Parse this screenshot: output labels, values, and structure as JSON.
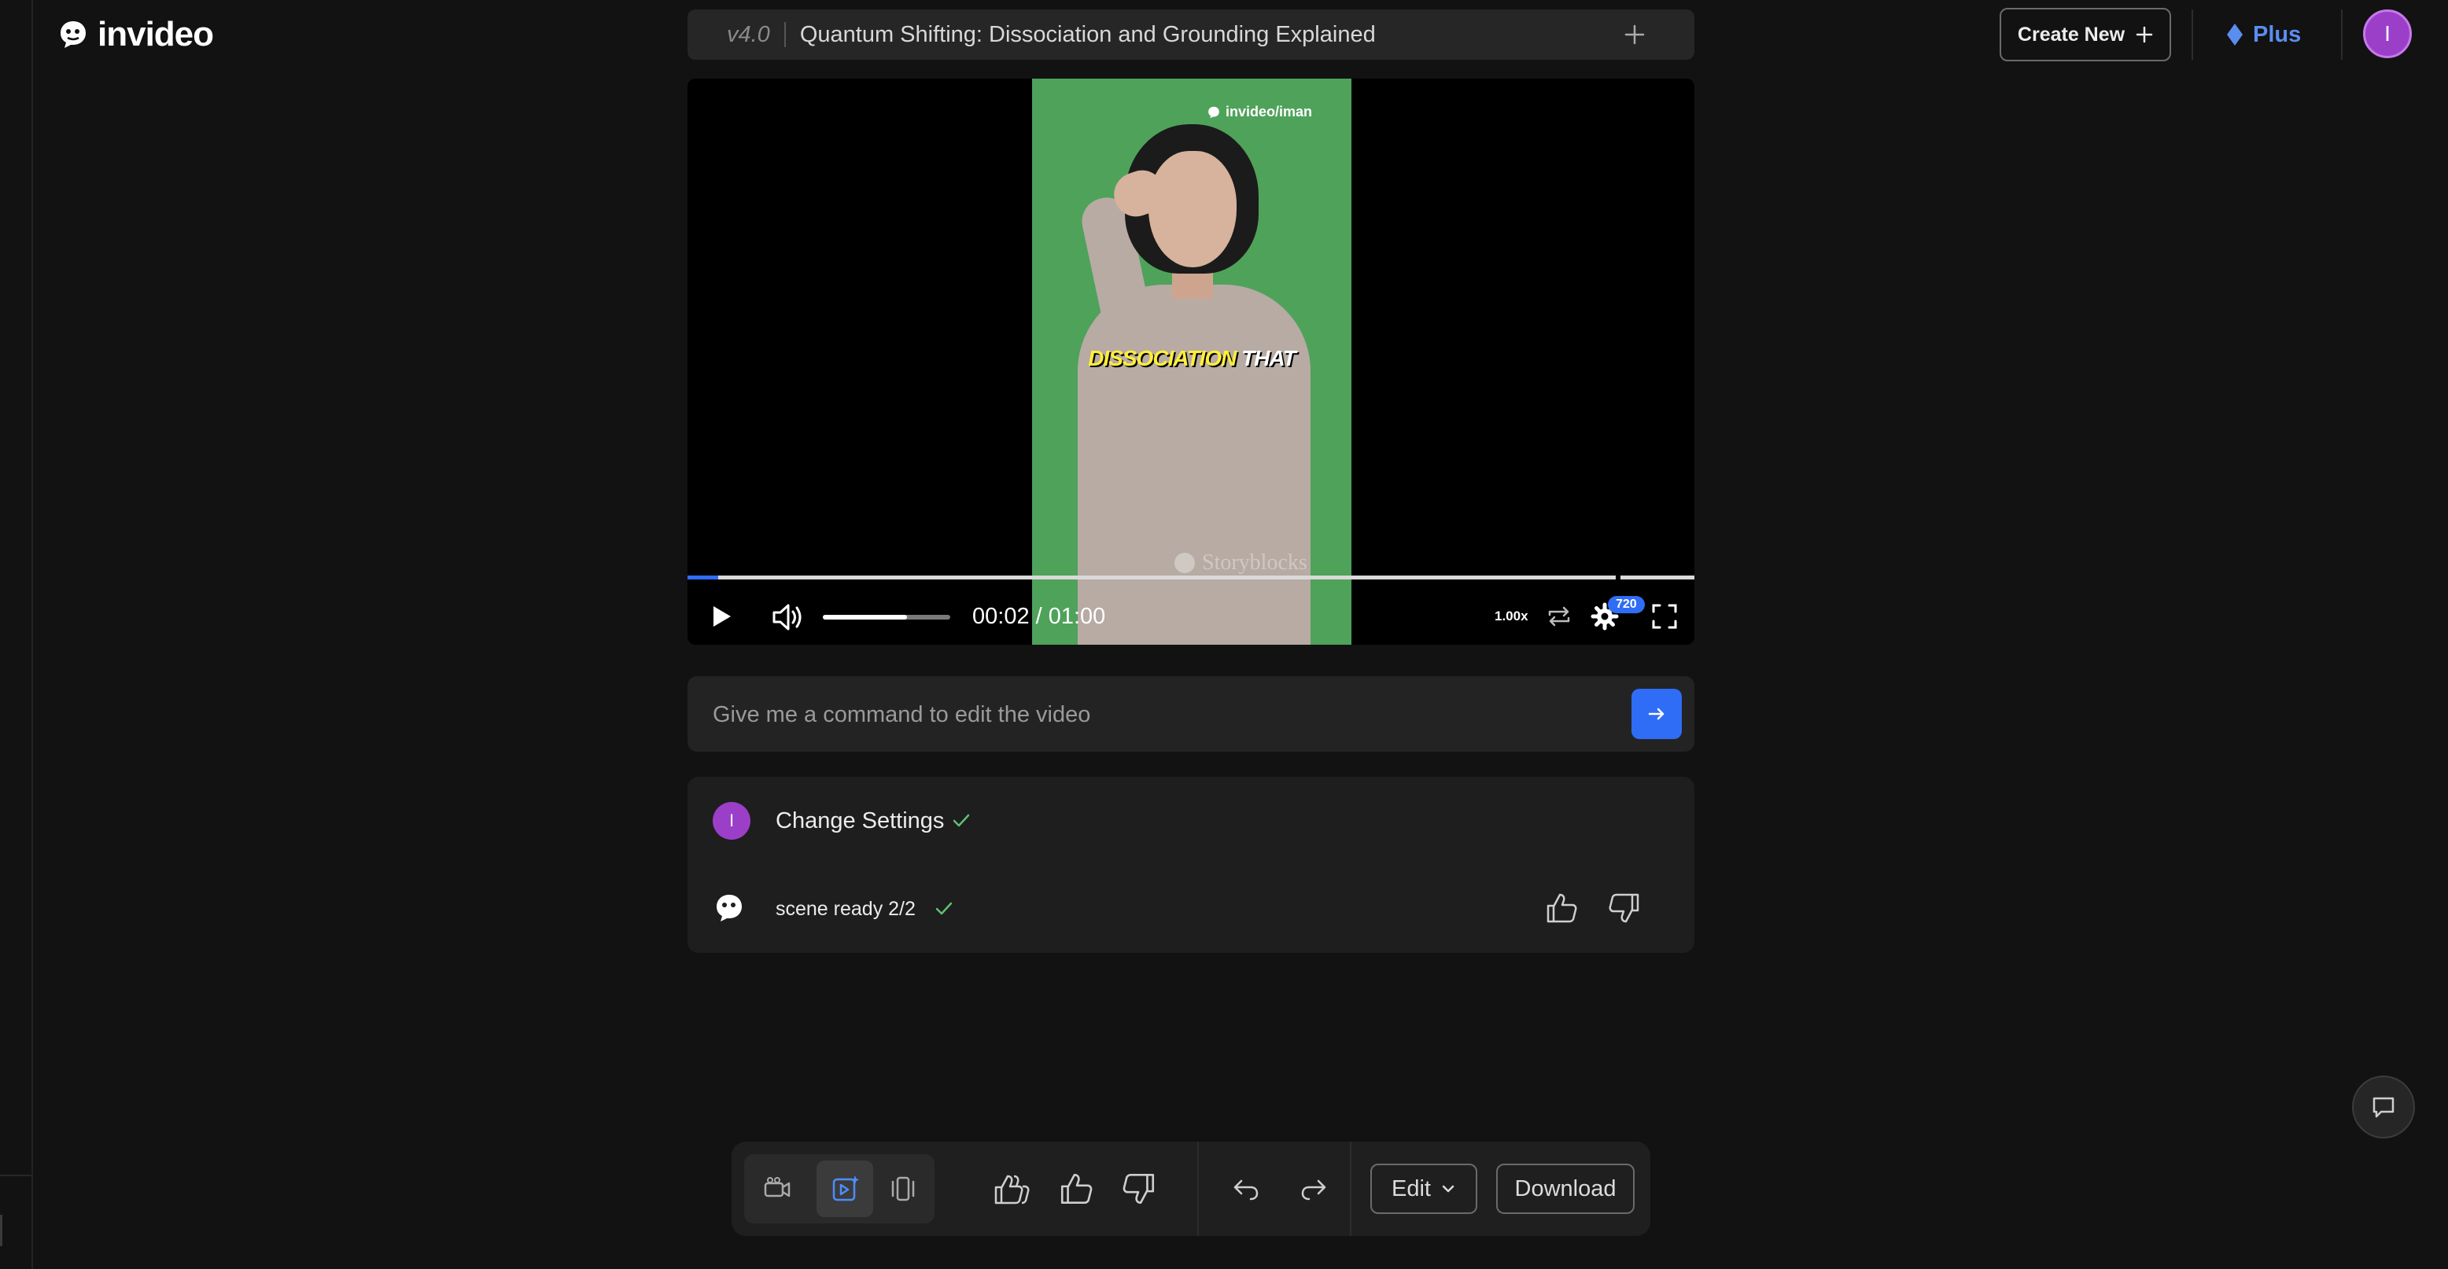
{
  "app": {
    "name": "invideo"
  },
  "header": {
    "version": "v4.0",
    "project_title": "Quantum Shifting: Dissociation and Grounding Explained",
    "create_new_label": "Create New",
    "plan_label": "Plus",
    "avatar_initial": "I"
  },
  "player": {
    "watermark_top": "invideo/iman",
    "caption_highlight": "DISSOCIATION",
    "caption_rest": "THAT",
    "watermark_bottom": "Storyblocks",
    "current_time": "00:02",
    "duration": "01:00",
    "time_display": "00:02 / 01:00",
    "progress_fraction": 0.033,
    "volume_fraction": 0.66,
    "speed": "1.00x",
    "quality": "720"
  },
  "command": {
    "placeholder": "Give me a command to edit the video"
  },
  "activity": {
    "user_initial": "I",
    "change_settings": "Change Settings",
    "scene_status": "scene ready 2/2"
  },
  "toolbar": {
    "edit_label": "Edit",
    "download_label": "Download"
  },
  "colors": {
    "accent": "#2f6df6",
    "avatar": "#9b3fc9",
    "plus": "#5b8def",
    "success": "#5fbf73",
    "background": "#121212"
  }
}
